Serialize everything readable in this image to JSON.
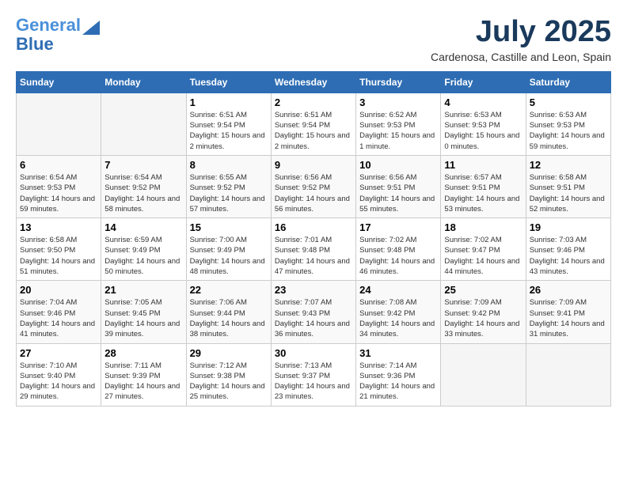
{
  "header": {
    "logo_line1": "General",
    "logo_line2": "Blue",
    "month_title": "July 2025",
    "location": "Cardenosa, Castille and Leon, Spain"
  },
  "days_of_week": [
    "Sunday",
    "Monday",
    "Tuesday",
    "Wednesday",
    "Thursday",
    "Friday",
    "Saturday"
  ],
  "weeks": [
    [
      {
        "day": "",
        "sunrise": "",
        "sunset": "",
        "daylight": ""
      },
      {
        "day": "",
        "sunrise": "",
        "sunset": "",
        "daylight": ""
      },
      {
        "day": "1",
        "sunrise": "Sunrise: 6:51 AM",
        "sunset": "Sunset: 9:54 PM",
        "daylight": "Daylight: 15 hours and 2 minutes."
      },
      {
        "day": "2",
        "sunrise": "Sunrise: 6:51 AM",
        "sunset": "Sunset: 9:54 PM",
        "daylight": "Daylight: 15 hours and 2 minutes."
      },
      {
        "day": "3",
        "sunrise": "Sunrise: 6:52 AM",
        "sunset": "Sunset: 9:53 PM",
        "daylight": "Daylight: 15 hours and 1 minute."
      },
      {
        "day": "4",
        "sunrise": "Sunrise: 6:53 AM",
        "sunset": "Sunset: 9:53 PM",
        "daylight": "Daylight: 15 hours and 0 minutes."
      },
      {
        "day": "5",
        "sunrise": "Sunrise: 6:53 AM",
        "sunset": "Sunset: 9:53 PM",
        "daylight": "Daylight: 14 hours and 59 minutes."
      }
    ],
    [
      {
        "day": "6",
        "sunrise": "Sunrise: 6:54 AM",
        "sunset": "Sunset: 9:53 PM",
        "daylight": "Daylight: 14 hours and 59 minutes."
      },
      {
        "day": "7",
        "sunrise": "Sunrise: 6:54 AM",
        "sunset": "Sunset: 9:52 PM",
        "daylight": "Daylight: 14 hours and 58 minutes."
      },
      {
        "day": "8",
        "sunrise": "Sunrise: 6:55 AM",
        "sunset": "Sunset: 9:52 PM",
        "daylight": "Daylight: 14 hours and 57 minutes."
      },
      {
        "day": "9",
        "sunrise": "Sunrise: 6:56 AM",
        "sunset": "Sunset: 9:52 PM",
        "daylight": "Daylight: 14 hours and 56 minutes."
      },
      {
        "day": "10",
        "sunrise": "Sunrise: 6:56 AM",
        "sunset": "Sunset: 9:51 PM",
        "daylight": "Daylight: 14 hours and 55 minutes."
      },
      {
        "day": "11",
        "sunrise": "Sunrise: 6:57 AM",
        "sunset": "Sunset: 9:51 PM",
        "daylight": "Daylight: 14 hours and 53 minutes."
      },
      {
        "day": "12",
        "sunrise": "Sunrise: 6:58 AM",
        "sunset": "Sunset: 9:51 PM",
        "daylight": "Daylight: 14 hours and 52 minutes."
      }
    ],
    [
      {
        "day": "13",
        "sunrise": "Sunrise: 6:58 AM",
        "sunset": "Sunset: 9:50 PM",
        "daylight": "Daylight: 14 hours and 51 minutes."
      },
      {
        "day": "14",
        "sunrise": "Sunrise: 6:59 AM",
        "sunset": "Sunset: 9:49 PM",
        "daylight": "Daylight: 14 hours and 50 minutes."
      },
      {
        "day": "15",
        "sunrise": "Sunrise: 7:00 AM",
        "sunset": "Sunset: 9:49 PM",
        "daylight": "Daylight: 14 hours and 48 minutes."
      },
      {
        "day": "16",
        "sunrise": "Sunrise: 7:01 AM",
        "sunset": "Sunset: 9:48 PM",
        "daylight": "Daylight: 14 hours and 47 minutes."
      },
      {
        "day": "17",
        "sunrise": "Sunrise: 7:02 AM",
        "sunset": "Sunset: 9:48 PM",
        "daylight": "Daylight: 14 hours and 46 minutes."
      },
      {
        "day": "18",
        "sunrise": "Sunrise: 7:02 AM",
        "sunset": "Sunset: 9:47 PM",
        "daylight": "Daylight: 14 hours and 44 minutes."
      },
      {
        "day": "19",
        "sunrise": "Sunrise: 7:03 AM",
        "sunset": "Sunset: 9:46 PM",
        "daylight": "Daylight: 14 hours and 43 minutes."
      }
    ],
    [
      {
        "day": "20",
        "sunrise": "Sunrise: 7:04 AM",
        "sunset": "Sunset: 9:46 PM",
        "daylight": "Daylight: 14 hours and 41 minutes."
      },
      {
        "day": "21",
        "sunrise": "Sunrise: 7:05 AM",
        "sunset": "Sunset: 9:45 PM",
        "daylight": "Daylight: 14 hours and 39 minutes."
      },
      {
        "day": "22",
        "sunrise": "Sunrise: 7:06 AM",
        "sunset": "Sunset: 9:44 PM",
        "daylight": "Daylight: 14 hours and 38 minutes."
      },
      {
        "day": "23",
        "sunrise": "Sunrise: 7:07 AM",
        "sunset": "Sunset: 9:43 PM",
        "daylight": "Daylight: 14 hours and 36 minutes."
      },
      {
        "day": "24",
        "sunrise": "Sunrise: 7:08 AM",
        "sunset": "Sunset: 9:42 PM",
        "daylight": "Daylight: 14 hours and 34 minutes."
      },
      {
        "day": "25",
        "sunrise": "Sunrise: 7:09 AM",
        "sunset": "Sunset: 9:42 PM",
        "daylight": "Daylight: 14 hours and 33 minutes."
      },
      {
        "day": "26",
        "sunrise": "Sunrise: 7:09 AM",
        "sunset": "Sunset: 9:41 PM",
        "daylight": "Daylight: 14 hours and 31 minutes."
      }
    ],
    [
      {
        "day": "27",
        "sunrise": "Sunrise: 7:10 AM",
        "sunset": "Sunset: 9:40 PM",
        "daylight": "Daylight: 14 hours and 29 minutes."
      },
      {
        "day": "28",
        "sunrise": "Sunrise: 7:11 AM",
        "sunset": "Sunset: 9:39 PM",
        "daylight": "Daylight: 14 hours and 27 minutes."
      },
      {
        "day": "29",
        "sunrise": "Sunrise: 7:12 AM",
        "sunset": "Sunset: 9:38 PM",
        "daylight": "Daylight: 14 hours and 25 minutes."
      },
      {
        "day": "30",
        "sunrise": "Sunrise: 7:13 AM",
        "sunset": "Sunset: 9:37 PM",
        "daylight": "Daylight: 14 hours and 23 minutes."
      },
      {
        "day": "31",
        "sunrise": "Sunrise: 7:14 AM",
        "sunset": "Sunset: 9:36 PM",
        "daylight": "Daylight: 14 hours and 21 minutes."
      },
      {
        "day": "",
        "sunrise": "",
        "sunset": "",
        "daylight": ""
      },
      {
        "day": "",
        "sunrise": "",
        "sunset": "",
        "daylight": ""
      }
    ]
  ]
}
